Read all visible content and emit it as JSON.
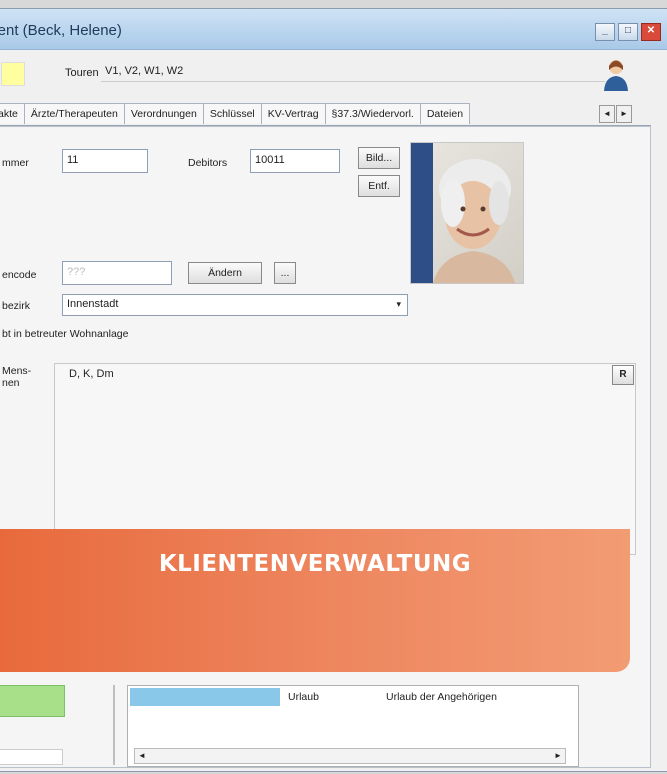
{
  "window": {
    "title": "lient (Beck, Helene)",
    "controls": {
      "minimize": "_",
      "maximize": "□",
      "close": "✕"
    }
  },
  "header": {
    "touren_label": "Touren",
    "touren_value": "V1, V2, W1, W2"
  },
  "tabs": [
    "akte",
    "Ärzte/Therapeuten",
    "Verordnungen",
    "Schlüssel",
    "KV-Vertrag",
    "§37.3/Wiedervorl.",
    "Dateien"
  ],
  "tab_scroll": {
    "left": "◄",
    "right": "►"
  },
  "form": {
    "nummer_label": "mmer",
    "nummer_value": "11",
    "debitors_label": "Debitors",
    "debitors_value": "10011",
    "bild_button": "Bild...",
    "entf_button": "Entf.",
    "zugangscode_label": "encode",
    "zugangscode_value": "???",
    "andern_button": "Ändern",
    "dots_button": "...",
    "bezirk_label": "bezirk",
    "bezirk_value": "Innenstadt",
    "wohnanlage_text": "bt in betreuter Wohnanlage",
    "info_label": "Mens-\nnen",
    "info_value": "D, K, Dm",
    "r_button": "R"
  },
  "banner": {
    "text": "KLIENTENVERWALTUNG"
  },
  "bottom": {
    "urlaub_label": "Urlaub",
    "urlaub_note": "Urlaub der Angehörigen"
  }
}
